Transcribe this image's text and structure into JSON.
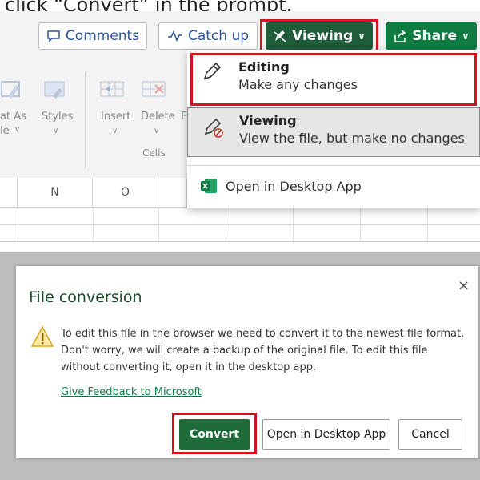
{
  "caption": "click “Convert” in the prompt.",
  "toolbar": {
    "comments_label": "Comments",
    "catchup_label": "Catch up",
    "viewing_label": "Viewing",
    "share_label": "Share"
  },
  "ribbon": {
    "format_as_label": "at As",
    "format_as_sub": "le",
    "styles_label": "Styles",
    "insert_label": "Insert",
    "delete_label": "Delete",
    "delete_extra": "F",
    "cells_group_label": "Cells"
  },
  "grid": {
    "col_n": "N",
    "col_o": "O"
  },
  "mode_menu": {
    "editing_title": "Editing",
    "editing_desc": "Make any changes",
    "viewing_title": "Viewing",
    "viewing_desc": "View the file, but make no changes",
    "open_desktop_label": "Open in Desktop App"
  },
  "dialog": {
    "title": "File conversion",
    "close_glyph": "×",
    "message": "To edit this file in the browser we need to convert it to the newest file format. Don't worry, we will create a backup of the original file. To edit this file without converting it, open it in the desktop app.",
    "feedback_link": "Give Feedback to Microsoft",
    "convert_label": "Convert",
    "open_desktop_label": "Open in Desktop App",
    "cancel_label": "Cancel"
  },
  "colors": {
    "highlight": "#d0161e",
    "excel_green": "#107c41",
    "viewing_green": "#1f5c3a",
    "link_green": "#107c41"
  }
}
